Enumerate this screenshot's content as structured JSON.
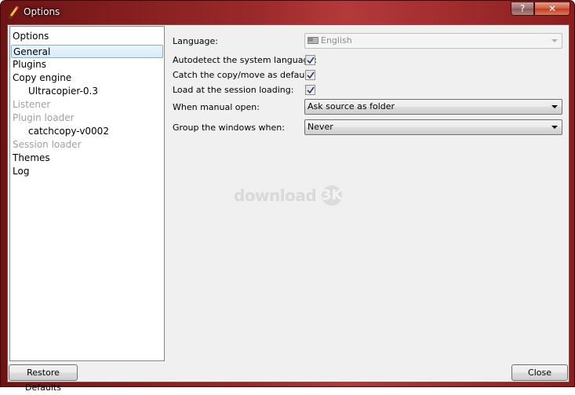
{
  "window": {
    "title": "Options",
    "controls": {
      "help_label": "?",
      "close_label": "✕"
    }
  },
  "sidebar": {
    "header": "Options",
    "items": [
      {
        "label": "General",
        "level": 0,
        "enabled": true,
        "selected": true
      },
      {
        "label": "Plugins",
        "level": 0,
        "enabled": true,
        "selected": false
      },
      {
        "label": "Copy engine",
        "level": 0,
        "enabled": true,
        "selected": false
      },
      {
        "label": "Ultracopier-0.3",
        "level": 1,
        "enabled": true,
        "selected": false
      },
      {
        "label": "Listener",
        "level": 0,
        "enabled": false,
        "selected": false
      },
      {
        "label": "Plugin loader",
        "level": 0,
        "enabled": false,
        "selected": false
      },
      {
        "label": "catchcopy-v0002",
        "level": 1,
        "enabled": true,
        "selected": false
      },
      {
        "label": "Session loader",
        "level": 0,
        "enabled": false,
        "selected": false
      },
      {
        "label": "Themes",
        "level": 0,
        "enabled": true,
        "selected": false
      },
      {
        "label": "Log",
        "level": 0,
        "enabled": true,
        "selected": false
      }
    ]
  },
  "general": {
    "language": {
      "label": "Language:",
      "value": "English",
      "enabled": false,
      "icon": "flag-icon"
    },
    "autodetect": {
      "label": "Autodetect the system language:",
      "checked": true
    },
    "catch_copy": {
      "label": "Catch the copy/move as default:",
      "checked": true
    },
    "load_session": {
      "label": "Load at the session loading:",
      "checked": true
    },
    "manual_open": {
      "label": "When manual open:",
      "value": "Ask source as folder"
    },
    "group_windows": {
      "label": "Group the windows when:",
      "value": "Never"
    }
  },
  "watermark": {
    "text": "download",
    "badge": "3K"
  },
  "footer": {
    "restore_label": "Restore Defaults",
    "close_label": "Close"
  },
  "colors": {
    "titlebar": "#9b2a2a",
    "selection_border": "#84acdd",
    "selection_fill": "#d9ecfc",
    "disabled_text": "#a0a0a0"
  }
}
